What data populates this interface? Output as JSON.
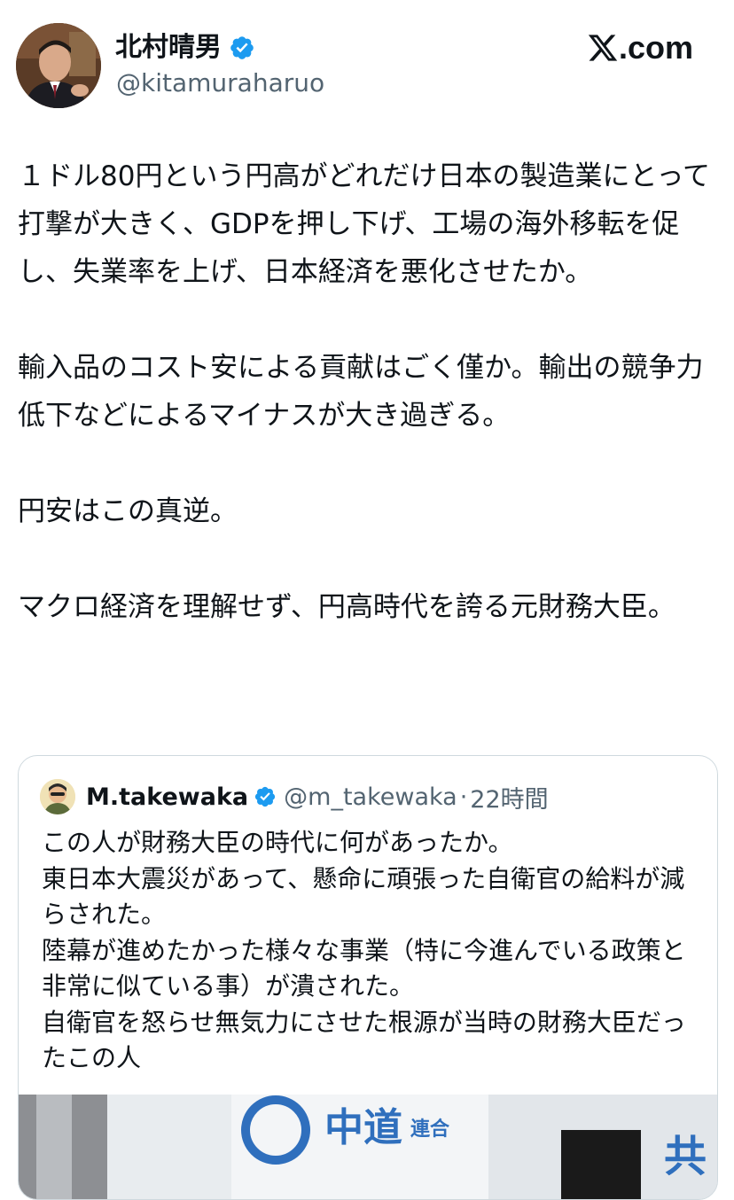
{
  "author": {
    "display_name": "北村晴男",
    "handle": "@kitamuraharuo",
    "verified": true
  },
  "brand": {
    "site": "com",
    "logo_icon": "x-logo-icon"
  },
  "tweet": {
    "paragraphs": [
      "１ドル80円という円高がどれだけ日本の製造業にとって打撃が大きく、GDPを押し下げ、工場の海外移転を促し、失業率を上げ、日本経済を悪化させたか。",
      "輸入品のコスト安による貢献はごく僅か。輸出の競争力低下などによるマイナスが大き過ぎる。",
      "円安はこの真逆。",
      "マクロ経済を理解せず、円高時代を誇る元財務大臣。"
    ]
  },
  "quoted_tweet": {
    "display_name": "M.takewaka",
    "handle": "@m_takewaka",
    "separator": "·",
    "time": "22時間",
    "verified": true,
    "text": "この人が財務大臣の時代に何があったか。\n東日本大震災があって、懸命に頑張った自衛官の給料が減らされた。\n陸幕が進めたかった様々な事業（特に今進んでいる政策と非常に似ている事）が潰された。\n自衛官を怒らせ無気力にさせた根源が当時の財務大臣だったこの人",
    "media_sign_text": "中道",
    "media_sign_sub": "連合",
    "media_sign_right": "共"
  },
  "colors": {
    "text_primary": "#0f1419",
    "text_secondary": "#536471",
    "verified_blue": "#1d9bf0",
    "border": "#cfd9de"
  }
}
